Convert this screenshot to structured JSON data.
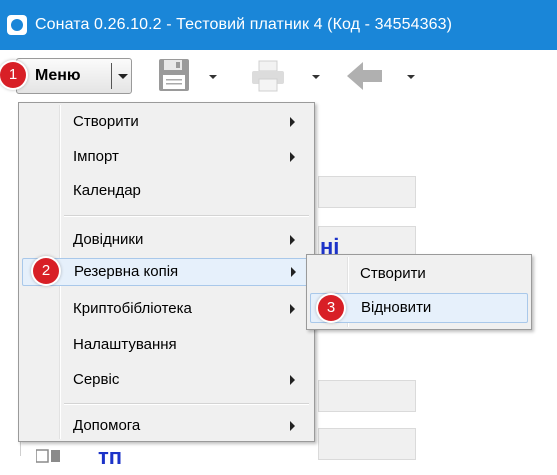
{
  "window": {
    "title": "Соната 0.26.10.2 - Тестовий платник 4 (Код - 34554363)"
  },
  "toolbar": {
    "menu_label": "Меню",
    "icons": [
      "save-icon",
      "print-icon",
      "back-arrow-icon"
    ]
  },
  "menu": {
    "items": [
      {
        "label": "Створити",
        "submenu": true
      },
      {
        "label": "Імпорт",
        "submenu": true
      },
      {
        "label": "Календар",
        "submenu": false
      },
      {
        "label": "Довідники",
        "submenu": true
      },
      {
        "label": "Резервна копія",
        "submenu": true,
        "highlighted": true
      },
      {
        "label": "Криптобібліотека",
        "submenu": true
      },
      {
        "label": "Налаштування",
        "submenu": false
      },
      {
        "label": "Сервіс",
        "submenu": true
      },
      {
        "label": "Допомога",
        "submenu": true
      }
    ]
  },
  "submenu": {
    "items": [
      {
        "label": "Створити"
      },
      {
        "label": "Відновити",
        "highlighted": true
      }
    ]
  },
  "steps": [
    "1",
    "2",
    "3"
  ],
  "colors": {
    "titlebar": "#1a86d8",
    "badge": "#d81f26",
    "highlight": "#e6f0fb",
    "link": "#1c33c8"
  }
}
